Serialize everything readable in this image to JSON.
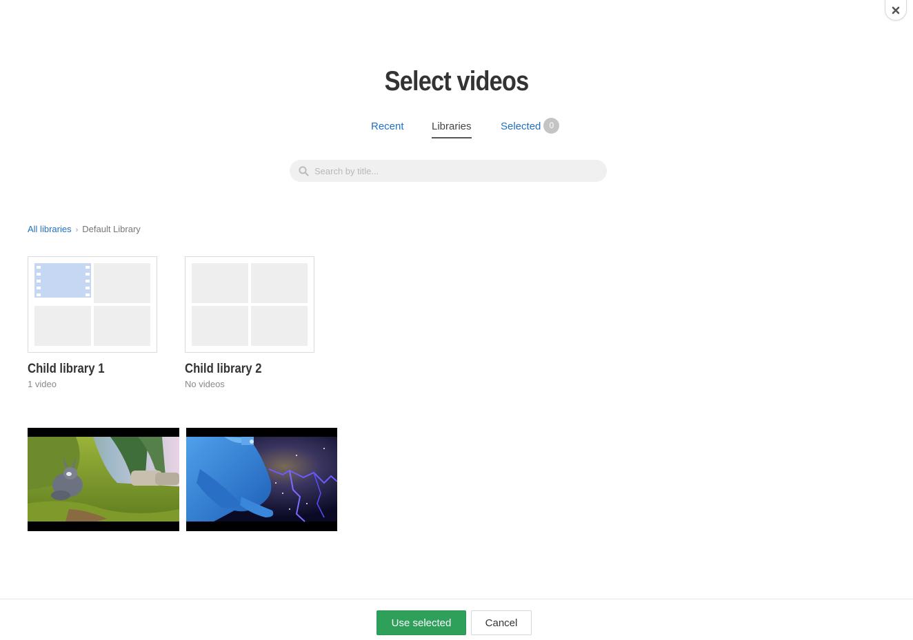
{
  "dialog": {
    "title": "Select videos",
    "close_icon": "close-icon"
  },
  "tabs": [
    {
      "label": "Recent",
      "active": false
    },
    {
      "label": "Libraries",
      "active": true
    },
    {
      "label": "Selected",
      "active": false,
      "count": "0"
    }
  ],
  "search": {
    "placeholder": "Search by title...",
    "value": "",
    "icon": "search-icon"
  },
  "breadcrumb": {
    "root": "All libraries",
    "current": "Default Library"
  },
  "libraries": [
    {
      "name": "Child library 1",
      "count": "1 video",
      "has_video_preview": true
    },
    {
      "name": "Child library 2",
      "count": "No videos",
      "has_video_preview": false
    }
  ],
  "videos": [
    {
      "thumbnail": "forest-scene-with-rabbit"
    },
    {
      "thumbnail": "blue-hand-with-lightning"
    }
  ],
  "footer": {
    "primary_label": "Use selected",
    "cancel_label": "Cancel"
  },
  "colors": {
    "link": "#1f6fc2",
    "primary_button": "#2fa05a",
    "badge": "#c4c4c4",
    "placeholder_tile": "#eeeeee"
  }
}
